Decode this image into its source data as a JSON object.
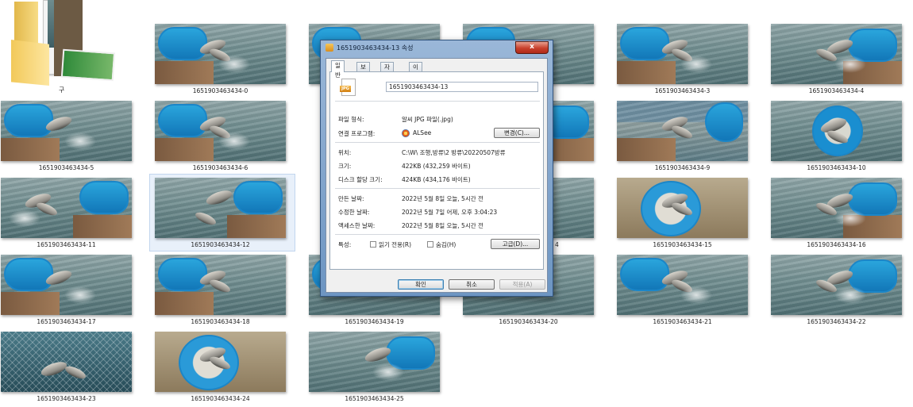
{
  "folder": {
    "label": "구"
  },
  "thumbnails": [
    "1651903463434-0",
    "1651903463434-3",
    "1651903463434-4",
    "1651903463434-5",
    "1651903463434-6",
    "1651903463434-9",
    "1651903463434-10",
    "1651903463434-11",
    "1651903463434-12",
    "1651903463434-15",
    "1651903463434-16",
    "1651903463434-17",
    "1651903463434-18",
    "1651903463434-19",
    "1651903463434-20",
    "1651903463434-21",
    "1651903463434-22",
    "1651903463434-23",
    "1651903463434-24",
    "1651903463434-25"
  ],
  "partial_labels": {
    "row1_col4": "2",
    "row2_col4": "8",
    "row3_col4": "4"
  },
  "dialog": {
    "title": "1651903463434-13 속성",
    "close_label": "x",
    "tabs": [
      "일반",
      "보안",
      "자세히",
      "이전 버전"
    ],
    "file_icon_label": "JPG",
    "filename": "1651903463434-13",
    "rows": {
      "type_label": "파일 형식:",
      "type_value": "알씨 JPG 파일(.jpg)",
      "opens_label": "연결 프로그램:",
      "opens_value": "ALSee",
      "change_button": "변경(C)...",
      "location_label": "위치:",
      "location_value": "C:\\W\\ 조행,방류\\2 방류\\20220507방류",
      "size_label": "크기:",
      "size_value": "422KB (432,259 바이트)",
      "disk_label": "디스크 할당 크기:",
      "disk_value": "424KB (434,176 바이트)",
      "created_label": "만든 날짜:",
      "created_value": "2022년 5월 8일 오늘, 5시간 전",
      "modified_label": "수정한 날짜:",
      "modified_value": "2022년 5월 7일 어제, 오후 3:04:23",
      "accessed_label": "액세스한 날짜:",
      "accessed_value": "2022년 5월 8일 오늘, 5시간 전",
      "attributes_label": "특성:",
      "readonly_label": "읽기 전용(R)",
      "hidden_label": "숨김(H)",
      "advanced_button": "고급(D)..."
    },
    "buttons": {
      "ok": "확인",
      "cancel": "취소",
      "apply": "적용(A)"
    }
  }
}
